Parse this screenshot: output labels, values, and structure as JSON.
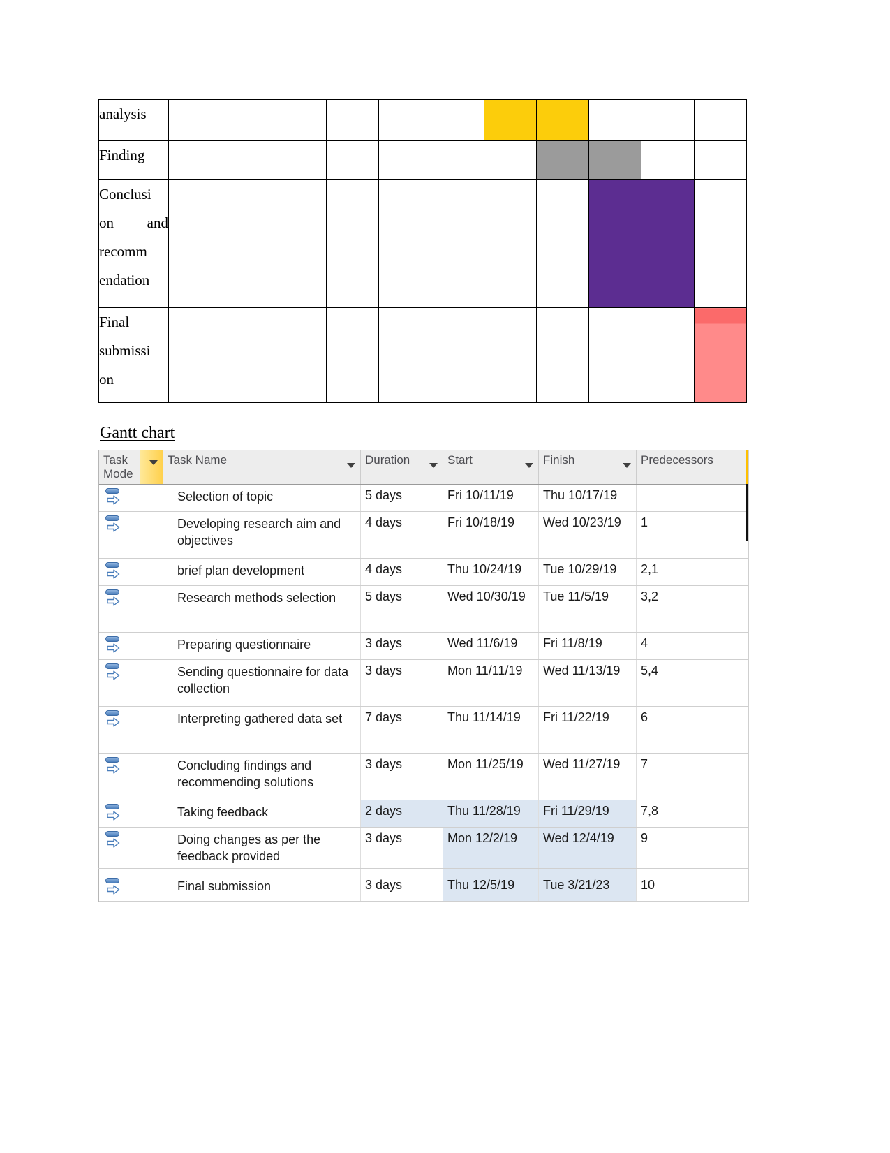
{
  "wbs_table": {
    "name": "work-breakdown-schedule-table",
    "column_count": 12,
    "rows": [
      {
        "label": "analysis",
        "label_lines": [
          "analysis"
        ],
        "fill": "yellow",
        "fill_color": "#FCCD0B",
        "fill_columns": [
          8,
          9
        ]
      },
      {
        "label": "Finding",
        "label_lines": [
          "Finding"
        ],
        "fill": "gray",
        "fill_color": "#9B9B9B",
        "fill_columns": [
          9,
          10
        ]
      },
      {
        "label": "Conclusion and recommendation",
        "label_lines": [
          "Conclusi",
          "on    and",
          "recomm",
          "endation"
        ],
        "fill": "purple",
        "fill_color": "#5C2D91",
        "fill_columns": [
          10,
          11
        ]
      },
      {
        "label": "Final submission",
        "label_lines": [
          "Final",
          "submissi",
          "on"
        ],
        "fill": "salmon",
        "fill_color": "#FF8A8A",
        "fill_columns": [
          12
        ]
      }
    ]
  },
  "gantt_heading": "Gantt chart",
  "project_grid": {
    "headers": {
      "task_mode": "Task\nMode",
      "task_name": "Task Name",
      "duration": "Duration",
      "start": "Start",
      "finish": "Finish",
      "predecessors": "Predecessors"
    },
    "rows": [
      {
        "mode_icon": "auto-schedule-icon",
        "name": "Selection of topic",
        "duration": "5 days",
        "start": "Fri 10/11/19",
        "finish": "Thu 10/17/19",
        "predecessors": "",
        "highlight": "none"
      },
      {
        "mode_icon": "auto-schedule-icon",
        "name": "Developing research aim and objectives",
        "duration": "4 days",
        "start": "Fri 10/18/19",
        "finish": "Wed 10/23/19",
        "predecessors": "1",
        "highlight": "none"
      },
      {
        "mode_icon": "auto-schedule-icon",
        "name": "brief plan development",
        "duration": "4 days",
        "start": "Thu 10/24/19",
        "finish": "Tue 10/29/19",
        "predecessors": "2,1",
        "highlight": "none"
      },
      {
        "mode_icon": "auto-schedule-icon",
        "name": "Research methods selection",
        "duration": "5 days",
        "start": "Wed 10/30/19",
        "finish": "Tue 11/5/19",
        "predecessors": "3,2",
        "highlight": "none"
      },
      {
        "mode_icon": "auto-schedule-icon",
        "name": "Preparing questionnaire",
        "duration": "3 days",
        "start": "Wed 11/6/19",
        "finish": "Fri 11/8/19",
        "predecessors": "4",
        "highlight": "none"
      },
      {
        "mode_icon": "auto-schedule-icon",
        "name": "Sending questionnaire for data collection",
        "duration": "3 days",
        "start": "Mon 11/11/19",
        "finish": "Wed 11/13/19",
        "predecessors": "5,4",
        "highlight": "none"
      },
      {
        "mode_icon": "auto-schedule-icon",
        "name": "Interpreting gathered data set",
        "duration": "7 days",
        "start": "Thu 11/14/19",
        "finish": "Fri 11/22/19",
        "predecessors": "6",
        "highlight": "none"
      },
      {
        "mode_icon": "auto-schedule-icon",
        "name": "Concluding findings and recommending solutions",
        "duration": "3 days",
        "start": "Mon 11/25/19",
        "finish": "Wed 11/27/19",
        "predecessors": "7",
        "highlight": "none"
      },
      {
        "mode_icon": "auto-schedule-icon",
        "name": "Taking feedback",
        "duration": "2 days",
        "start": "Thu 11/28/19",
        "finish": "Fri 11/29/19",
        "predecessors": "7,8",
        "highlight": "dur-start-finish"
      },
      {
        "mode_icon": "auto-schedule-icon",
        "name": "Doing changes as per the feedback provided",
        "duration": "3 days",
        "start": "Mon 12/2/19",
        "finish": "Wed 12/4/19",
        "predecessors": "9",
        "highlight": "start-finish"
      },
      {
        "mode_icon": "auto-schedule-icon",
        "name": "Final submission",
        "duration": "3 days",
        "start": "Thu 12/5/19",
        "finish": "Tue 3/21/23",
        "predecessors": "10",
        "highlight": "start-finish"
      }
    ]
  },
  "colors": {
    "yellow": "#FCCD0B",
    "gray": "#9B9B9B",
    "purple": "#5C2D91",
    "salmon": "#FF8A8A",
    "salmon_dark": "#FB6A6A",
    "header_bg": "#EDEDED",
    "highlight_bg": "#DCE6F2",
    "filter_gold": "#FFD04A",
    "page_bg": "#FFFFFF"
  }
}
